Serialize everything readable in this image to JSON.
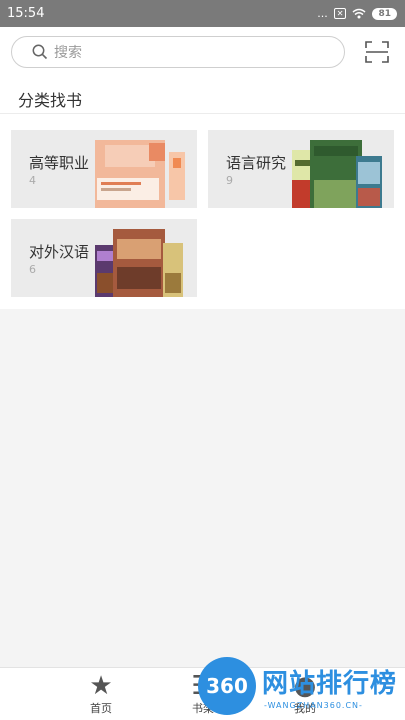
{
  "status_bar": {
    "time": "15:54",
    "dots": "...",
    "sim": "✕",
    "battery": "81"
  },
  "search": {
    "placeholder": "搜索"
  },
  "section": {
    "title": "分类找书"
  },
  "categories": [
    {
      "name": "高等职业",
      "count": "4"
    },
    {
      "name": "语言研究",
      "count": "9"
    },
    {
      "name": "对外汉语",
      "count": "6"
    }
  ],
  "tabs": [
    {
      "label": "首页",
      "icon": "star-icon"
    },
    {
      "label": "书架",
      "icon": "bookshelf-icon"
    },
    {
      "label": "我的",
      "icon": "profile-icon"
    }
  ],
  "watermark": {
    "logo": "360",
    "title": "网站排行榜",
    "subtitle": "-WANGZHAN360.CN-"
  },
  "colors": {
    "status_bar": "#7a7a7a",
    "card_bg": "#ebebeb",
    "watermark": "#2d8fe0"
  }
}
